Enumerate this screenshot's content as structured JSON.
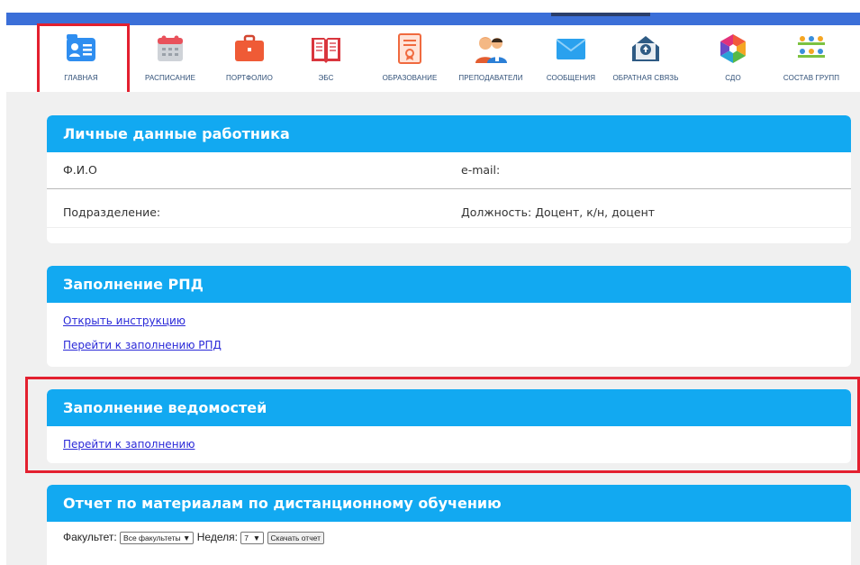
{
  "nav": [
    {
      "label": "ГЛАВНАЯ",
      "icon": "user-card-icon"
    },
    {
      "label": "РАСПИСАНИЕ",
      "icon": "calendar-icon"
    },
    {
      "label": "ПОРТФОЛИО",
      "icon": "briefcase-icon"
    },
    {
      "label": "ЭБС",
      "icon": "book-icon"
    },
    {
      "label": "ОБРАЗОВАНИЕ",
      "icon": "certificate-icon"
    },
    {
      "label": "ПРЕПОДАВАТЕЛИ",
      "icon": "teachers-icon"
    },
    {
      "label": "СООБЩЕНИЯ",
      "icon": "envelope-icon"
    },
    {
      "label": "ОБРАТНАЯ СВЯЗЬ",
      "icon": "feedback-icon"
    },
    {
      "label": "СДО",
      "icon": "hexagon-icon"
    },
    {
      "label": "СОСТАВ ГРУПП",
      "icon": "group-icon"
    }
  ],
  "personal": {
    "title": "Личные данные работника",
    "fio_label": "Ф.И.О",
    "email_label": "e-mail:",
    "division_label": "Подразделение:",
    "position_label": "Должность: Доцент, к/н, доцент"
  },
  "rpd": {
    "title": "Заполнение РПД",
    "link1": "Открыть инструкцию",
    "link2": "Перейти к заполнению РПД"
  },
  "sheets": {
    "title": "Заполнение ведомостей",
    "link": "Перейти к заполнению"
  },
  "report": {
    "title": "Отчет по материалам по дистанционному обучению",
    "faculty_label": "Факультет:",
    "faculty_value": "Все факультеты",
    "week_label": "Неделя:",
    "week_value": "7",
    "download_button": "Скачать отчет"
  },
  "colors": {
    "header": "#12a9f1",
    "topbar": "#3b6fd8",
    "highlight": "#e3202f",
    "link": "#2a29d8"
  }
}
